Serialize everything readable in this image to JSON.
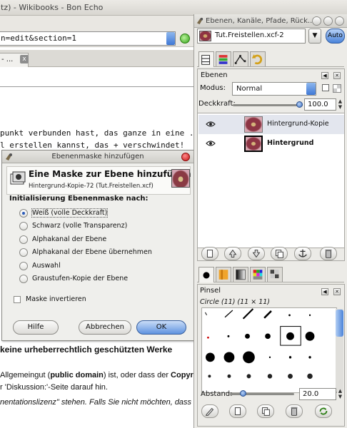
{
  "browser": {
    "title": "tz) - Wikibooks - Bon Echo",
    "url": "n=edit&section=1",
    "tab_label": "- ...",
    "tab_close": "x",
    "page_lines": {
      "line1": "punkt verbunden hast, das ganze in eine .",
      "line2": "l erstellen kannst, das + verschwindet!",
      "heading": "keine urheberrechtlich geschützten Werke",
      "p1_a": "Allgemeingut (",
      "p1_bold": "public domain",
      "p1_b": ") ist, oder dass der ",
      "p1_c": "Copyr",
      "p2": "r 'Diskussion:'-Seite darauf hin.",
      "p3": "nentationslizenz\" stehen. Falls Sie nicht möchten, dass"
    }
  },
  "dialog": {
    "title": "Ebenenmaske hinzufügen",
    "header_title": "Eine Maske zur Ebene hinzufügen",
    "header_subtitle": "Hintergrund-Kopie-72 (Tut.Freistellen.xcf)",
    "group_label": "Initialisierung Ebenenmaske nach:",
    "options": [
      {
        "label": "Weiß (volle Deckkraft)",
        "selected": true
      },
      {
        "label": "Schwarz (volle Transparenz)",
        "selected": false
      },
      {
        "label": "Alphakanal der Ebene",
        "selected": false
      },
      {
        "label": "Alphakanal der Ebene übernehmen",
        "selected": false
      },
      {
        "label": "Auswahl",
        "selected": false
      },
      {
        "label": "Graustufen-Kopie der Ebene",
        "selected": false
      }
    ],
    "invert_label": "Maske invertieren",
    "invert_checked": false,
    "buttons": {
      "help": "Hilfe",
      "cancel": "Abbrechen",
      "ok": "OK"
    }
  },
  "dock": {
    "title": "Ebenen, Kanäle, Pfade, Rück...",
    "image_name": "Tut.Freistellen.xcf-2",
    "auto_label": "Auto",
    "layers_panel": {
      "title": "Ebenen",
      "mode_label": "Modus:",
      "mode_value": "Normal",
      "opacity_label": "Deckkraft:",
      "opacity_value": "100.0",
      "opacity_level_percent": 100,
      "layers": [
        {
          "name": "Hintergrund-Kopie",
          "visible": true,
          "selected": true,
          "bold": false
        },
        {
          "name": "Hintergrund",
          "visible": true,
          "selected": false,
          "bold": true
        }
      ]
    },
    "brushes_panel": {
      "title": "Pinsel",
      "brush_name": "Circle (11) (11 × 11)",
      "spacing_label": "Abstand:",
      "spacing_value": "20.0",
      "spacing_level_percent": 20
    },
    "colors": {
      "accent": "#4a84da",
      "selection": "#e3e6ee"
    }
  }
}
